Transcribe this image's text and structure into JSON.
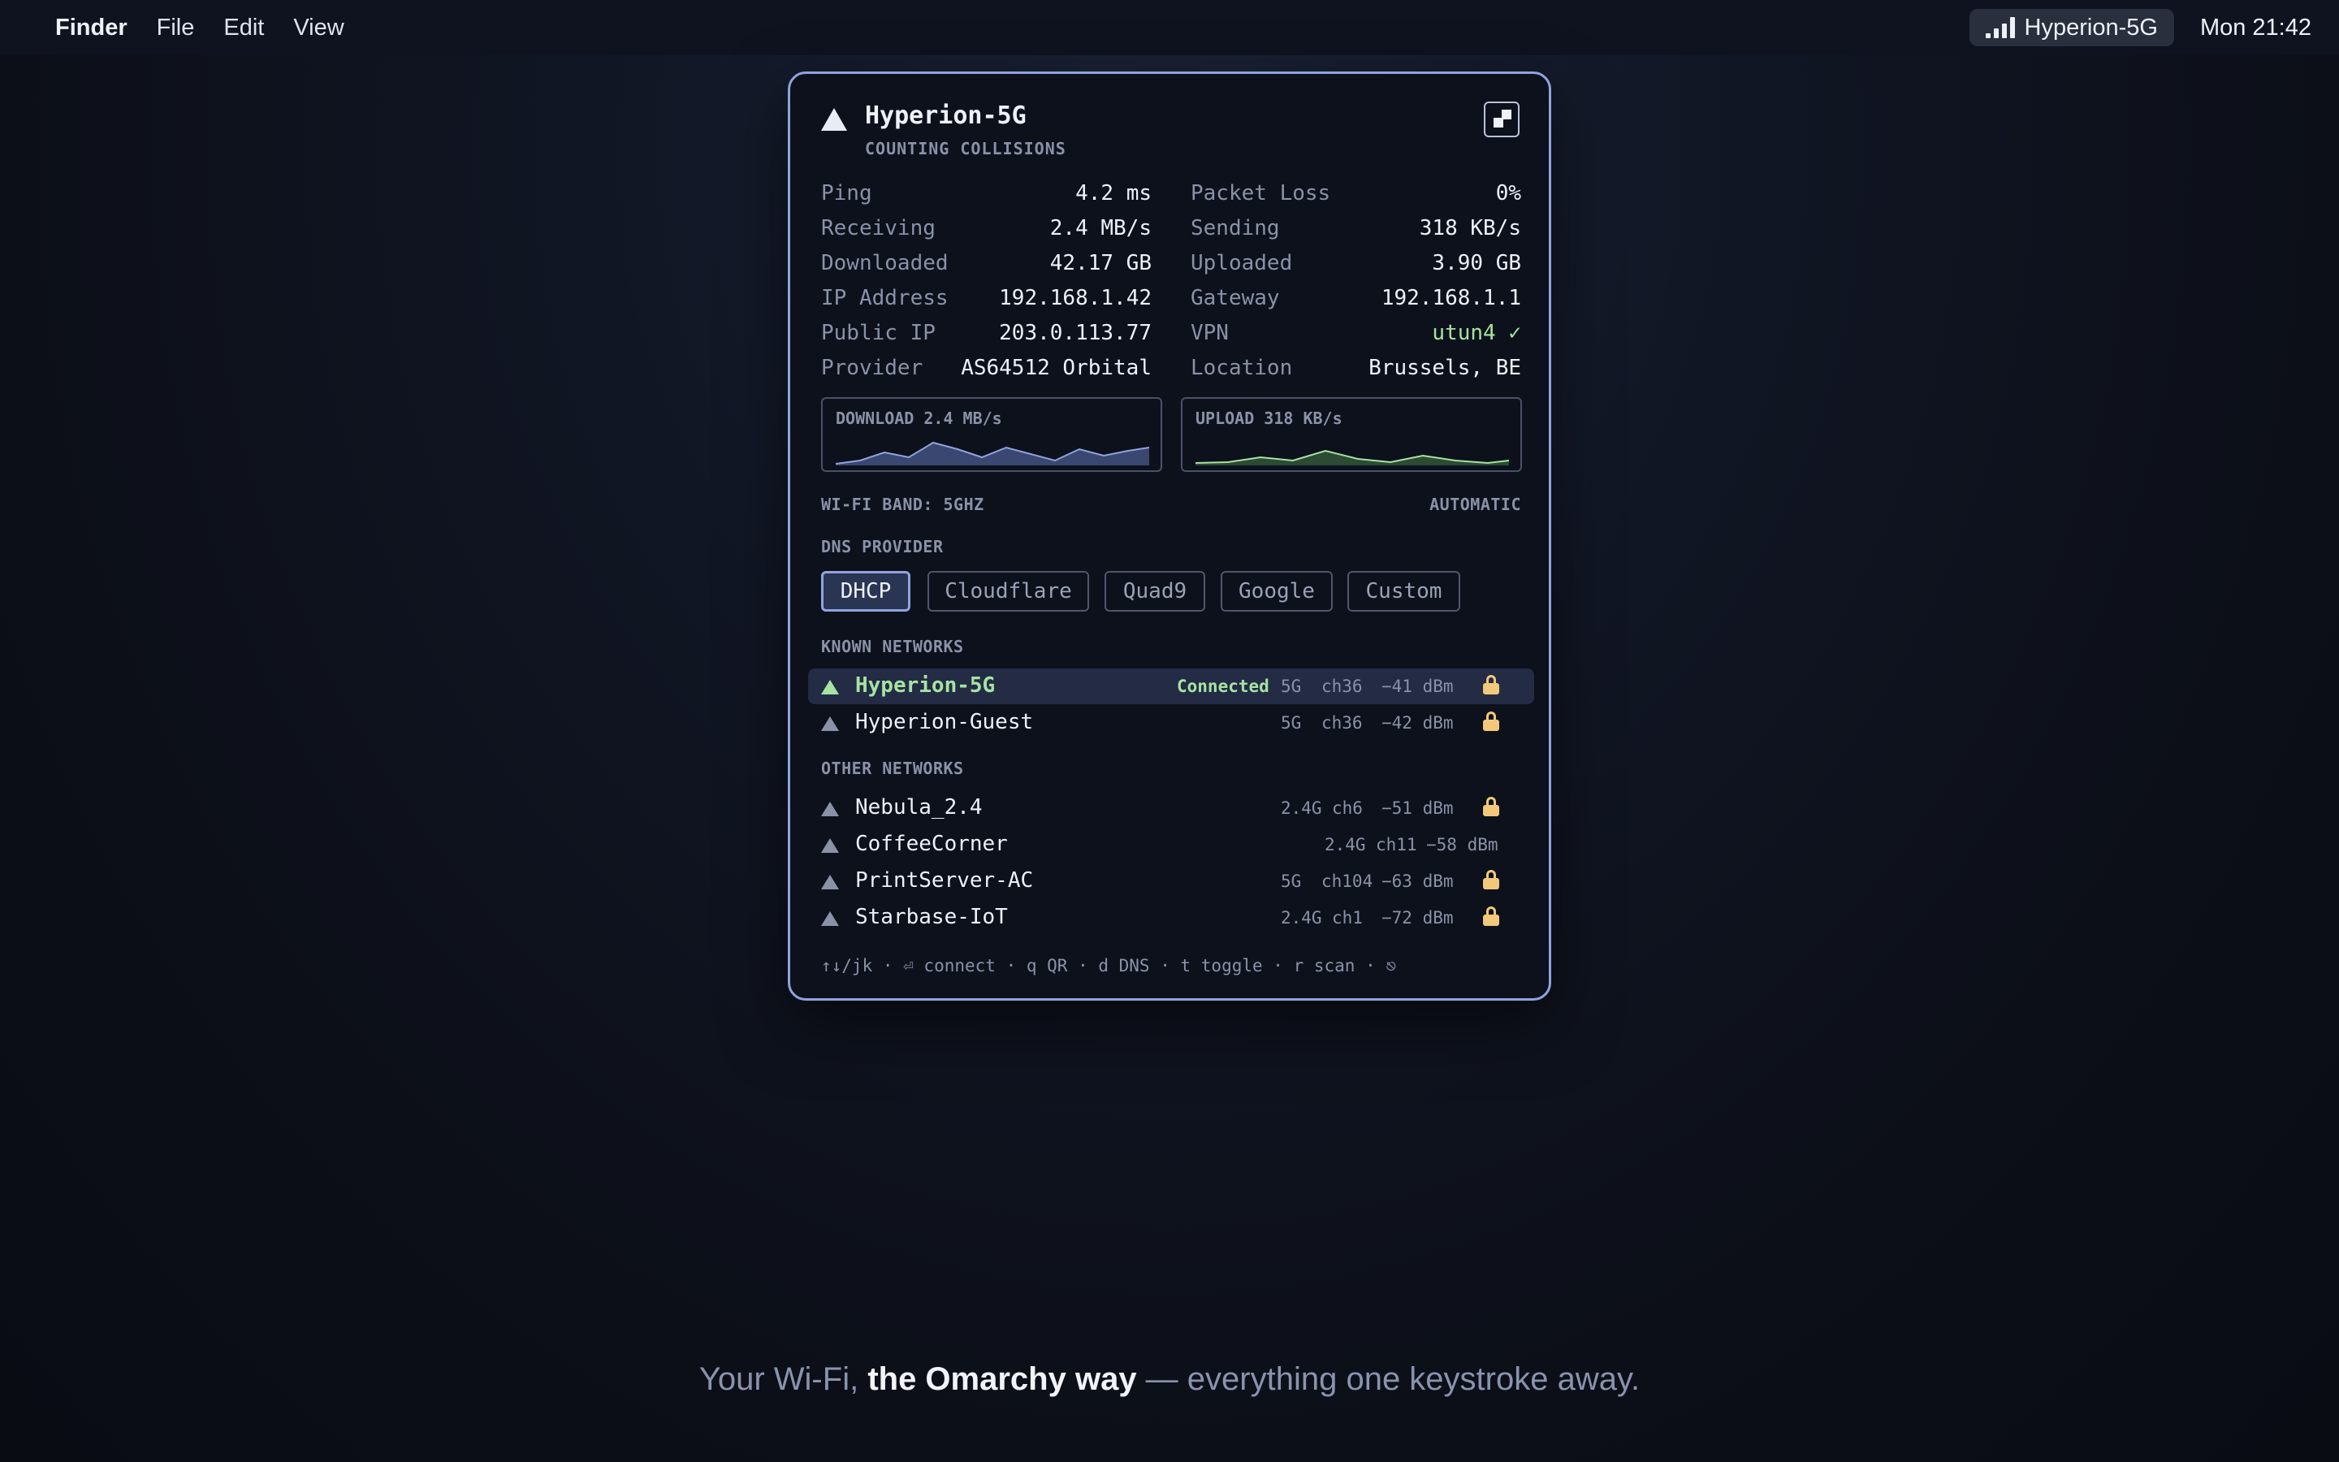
{
  "menubar": {
    "app": "Finder",
    "menus": [
      "File",
      "Edit",
      "View"
    ],
    "wifi_name": "Hyperion-5G",
    "clock": "Mon 21:42"
  },
  "panel": {
    "title": "Hyperion-5G",
    "subtitle": "COUNTING COLLISIONS",
    "qr_icon": "qr-code-icon",
    "stats": [
      {
        "l1": "Ping",
        "v1": "4.2 ms",
        "l2": "Packet Loss",
        "v2": "0%"
      },
      {
        "l1": "Receiving",
        "v1": "2.4 MB/s",
        "l2": "Sending",
        "v2": "318 KB/s"
      },
      {
        "l1": "Downloaded",
        "v1": "42.17 GB",
        "l2": "Uploaded",
        "v2": "3.90 GB"
      },
      {
        "l1": "IP Address",
        "v1": "192.168.1.42",
        "l2": "Gateway",
        "v2": "192.168.1.1"
      },
      {
        "l1": "Public IP",
        "v1": "203.0.113.77",
        "l2": "VPN",
        "v2": "utun4 ✓"
      },
      {
        "l1": "Provider",
        "v1": "AS64512 Orbital",
        "l2": "Location",
        "v2": "Brussels, BE"
      }
    ],
    "download_graph_label": "DOWNLOAD 2.4 MB/s",
    "upload_graph_label": "UPLOAD 318 KB/s",
    "band_label": "WI-FI BAND: 5GHZ",
    "band_mode": "AUTOMATIC",
    "dns_label": "DNS PROVIDER",
    "dns_options": [
      "DHCP",
      "Cloudflare",
      "Quad9",
      "Google",
      "Custom"
    ],
    "dns_selected": "DHCP",
    "known_label": "KNOWN NETWORKS",
    "known_networks": [
      {
        "name": "Hyperion-5G",
        "status": "Connected",
        "band": "5G",
        "channel": "ch36",
        "signal": "−41 dBm",
        "locked": true
      },
      {
        "name": "Hyperion-Guest",
        "status": "",
        "band": "5G",
        "channel": "ch36",
        "signal": "−42 dBm",
        "locked": true
      }
    ],
    "other_label": "OTHER NETWORKS",
    "other_networks": [
      {
        "name": "Nebula_2.4",
        "band": "2.4G",
        "channel": "ch6",
        "signal": "−51 dBm",
        "locked": true
      },
      {
        "name": "CoffeeCorner",
        "band": "2.4G",
        "channel": "ch11",
        "signal": "−58 dBm",
        "locked": false
      },
      {
        "name": "PrintServer-AC",
        "band": "5G",
        "channel": "ch104",
        "signal": "−63 dBm",
        "locked": true
      },
      {
        "name": "Starbase-IoT",
        "band": "2.4G",
        "channel": "ch1",
        "signal": "−72 dBm",
        "locked": true
      }
    ],
    "footer": "↑↓/jk · ⏎ connect · q QR · d DNS · t toggle · r scan · ⎋"
  },
  "colors": {
    "accent": "#8fa4de",
    "connected": "#a6e3a1",
    "lock": "#f2c87a",
    "muted": "#8a92a8"
  },
  "tagline": {
    "pre": "Your Wi-Fi, ",
    "bold": "the Omarchy way",
    "post": " — everything one keystroke away."
  }
}
